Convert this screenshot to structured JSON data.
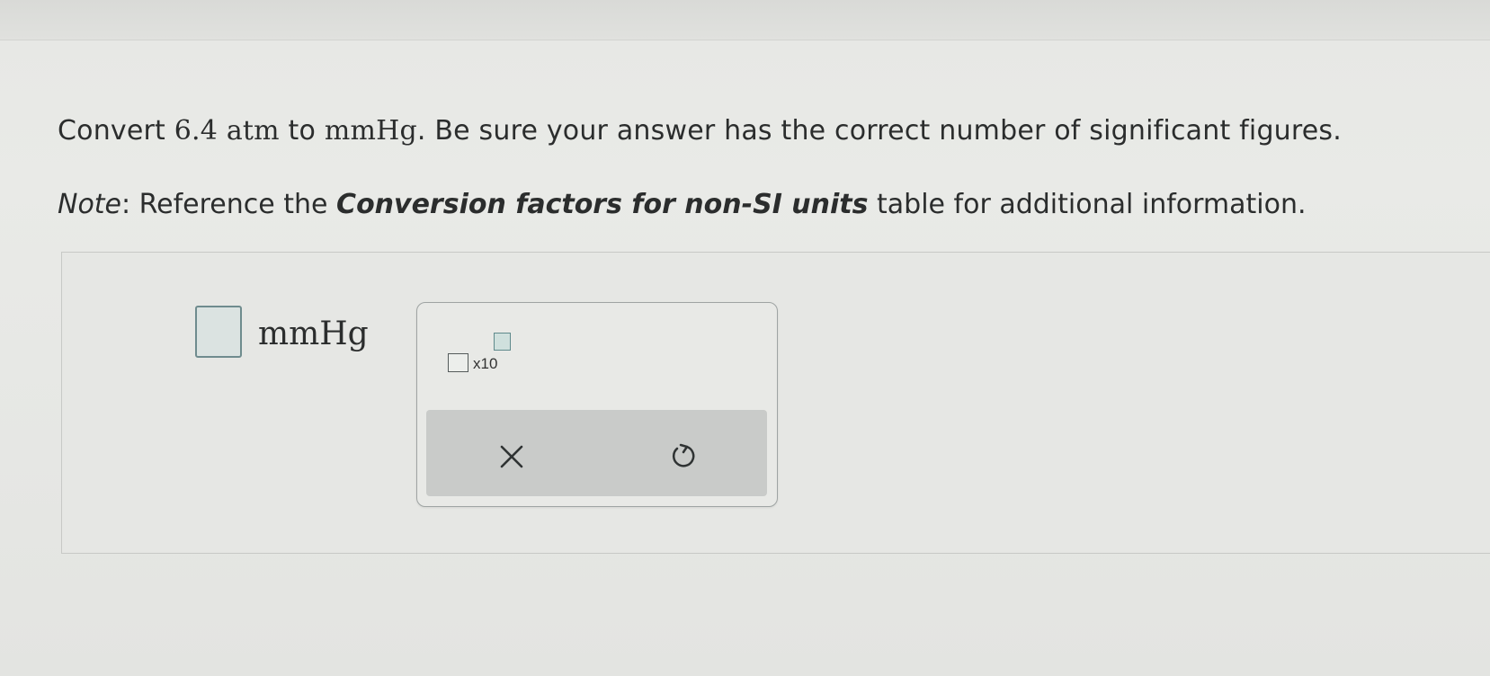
{
  "question": {
    "prefix": "Convert ",
    "value": "6.4",
    "from_unit": " atm",
    "middle": " to ",
    "to_unit": "mmHg",
    "suffix": ". Be sure your answer has the correct number of significant figures."
  },
  "note": {
    "label": "Note",
    "colon": ": Reference the ",
    "table_name": "Conversion factors for non-SI units",
    "tail": " table for additional information."
  },
  "answer": {
    "input_value": "",
    "unit": "mmHg"
  },
  "keypad": {
    "sci_notation_label": "x10",
    "clear_icon": "close-icon",
    "undo_icon": "undo-icon"
  },
  "colors": {
    "input_border": "#6f8c8e",
    "input_fill": "#dbe3e1",
    "action_bar": "#c9cbc9",
    "text": "#2b2d2d"
  }
}
